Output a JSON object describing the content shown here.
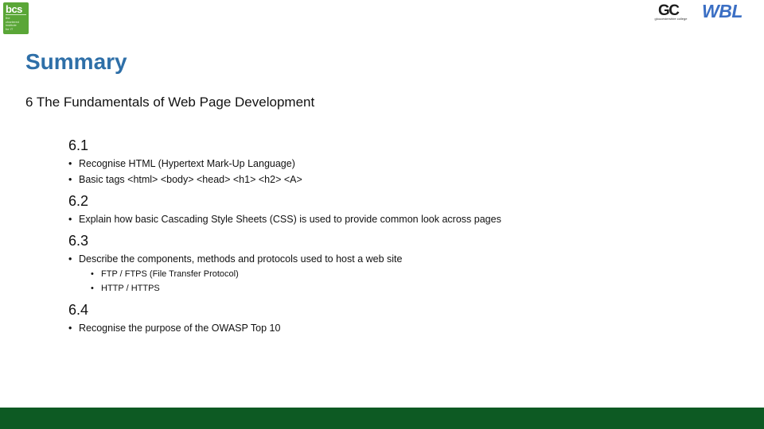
{
  "logos": {
    "bcs": {
      "word": "bcs",
      "tagline": "the\nchartered\ninstitute\nfor IT",
      "color": "#5aa637"
    },
    "gc": {
      "mark": "GC",
      "text": "gloucestershire college"
    },
    "wbl": {
      "text": "WBL",
      "color": "#3b6fc4"
    }
  },
  "title": "Summary",
  "unit": "6 The Fundamentals of Web Page Development",
  "sections": [
    {
      "heading": "6.1",
      "bullets": [
        "Recognise HTML (Hypertext Mark-Up Language)",
        "Basic tags <html> <body> <head> <h1> <h2> <A>"
      ]
    },
    {
      "heading": "6.2",
      "bullets": [
        "Explain how basic Cascading Style Sheets (CSS) is used to provide common look across pages"
      ]
    },
    {
      "heading": "6.3",
      "bullets": [
        "Describe the components, methods and protocols used to host a web site"
      ],
      "subbullets": [
        "FTP / FTPS (File Transfer Protocol)",
        "HTTP / HTTPS"
      ]
    },
    {
      "heading": "6.4",
      "bullets": [
        "Recognise the purpose of the OWASP Top 10"
      ]
    }
  ],
  "colors": {
    "title": "#2e6fa8",
    "footer": "#0d5a23"
  }
}
